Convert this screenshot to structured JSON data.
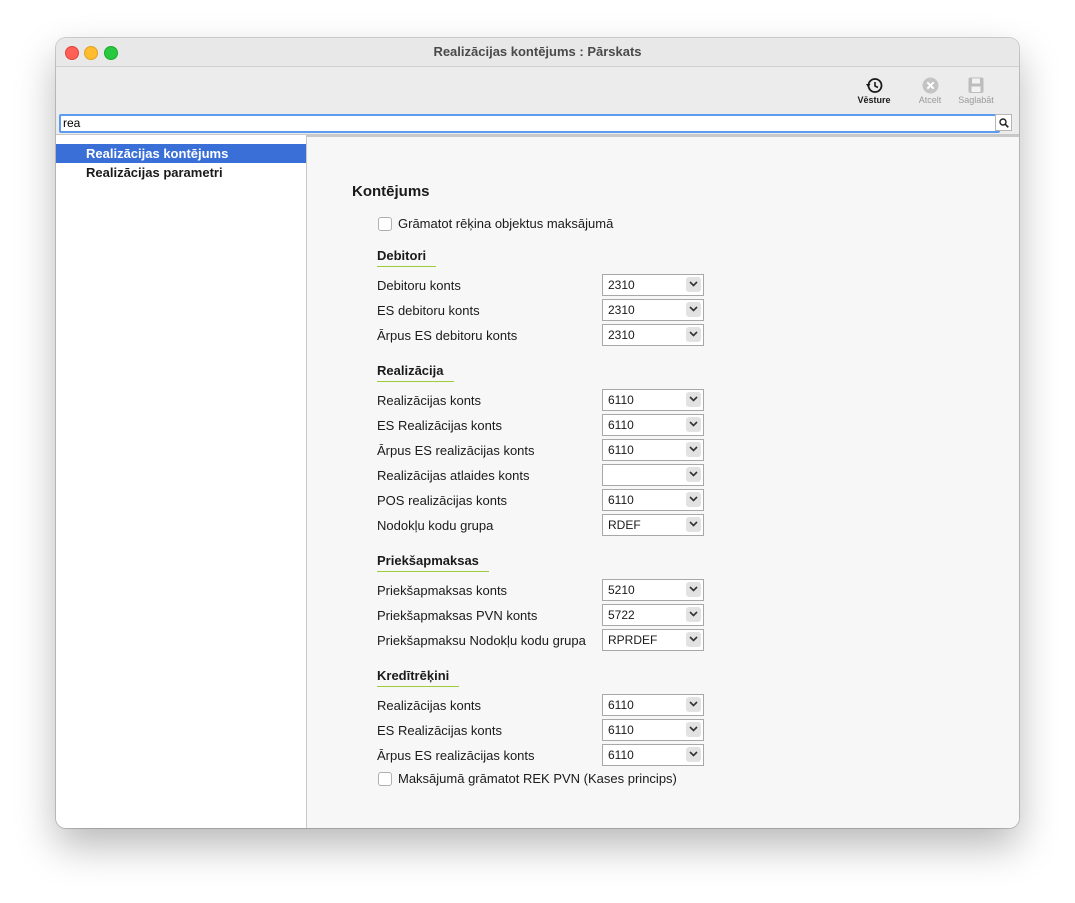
{
  "window": {
    "title": "Realizācijas kontējums : Pārskats"
  },
  "toolbar": {
    "history_label": "Vēsture",
    "cancel_label": "Atcelt",
    "save_label": "Saglabāt"
  },
  "search": {
    "value": "rea"
  },
  "sidebar": {
    "items": [
      {
        "label": "Realizācijas kontējums",
        "selected": true
      },
      {
        "label": "Realizācijas parametri",
        "selected": false
      }
    ]
  },
  "form": {
    "title": "Kontējums",
    "checkbox_top": {
      "label": "Grāmatot rēķina objektus maksājumā",
      "checked": false
    },
    "debitori": {
      "title": "Debitori",
      "fields": [
        {
          "label": "Debitoru konts",
          "value": "2310"
        },
        {
          "label": "ES debitoru konts",
          "value": "2310"
        },
        {
          "label": "Ārpus ES debitoru konts",
          "value": "2310"
        }
      ]
    },
    "realizacija": {
      "title": "Realizācija",
      "fields": [
        {
          "label": "Realizācijas konts",
          "value": "6110"
        },
        {
          "label": "ES Realizācijas konts",
          "value": "6110"
        },
        {
          "label": "Ārpus ES realizācijas konts",
          "value": "6110"
        },
        {
          "label": "Realizācijas atlaides konts",
          "value": ""
        },
        {
          "label": "POS realizācijas konts",
          "value": "6110"
        },
        {
          "label": "Nodokļu kodu grupa",
          "value": "RDEF"
        }
      ]
    },
    "priekssapmaksas": {
      "title": "Priekšapmaksas",
      "fields": [
        {
          "label": "Priekšapmaksas konts",
          "value": "5210"
        },
        {
          "label": "Priekšapmaksas PVN konts",
          "value": "5722"
        },
        {
          "label": "Priekšapmaksu Nodokļu kodu grupa",
          "value": "RPRDEF"
        }
      ]
    },
    "kreditrekini": {
      "title": "Kredītrēķini",
      "fields": [
        {
          "label": "Realizācijas konts",
          "value": "6110"
        },
        {
          "label": "ES Realizācijas konts",
          "value": "6110"
        },
        {
          "label": "Ārpus ES realizācijas konts",
          "value": "6110"
        }
      ]
    },
    "checkbox_bottom": {
      "label": "Maksājumā grāmatot REK PVN (Kases princips)",
      "checked": false
    }
  }
}
